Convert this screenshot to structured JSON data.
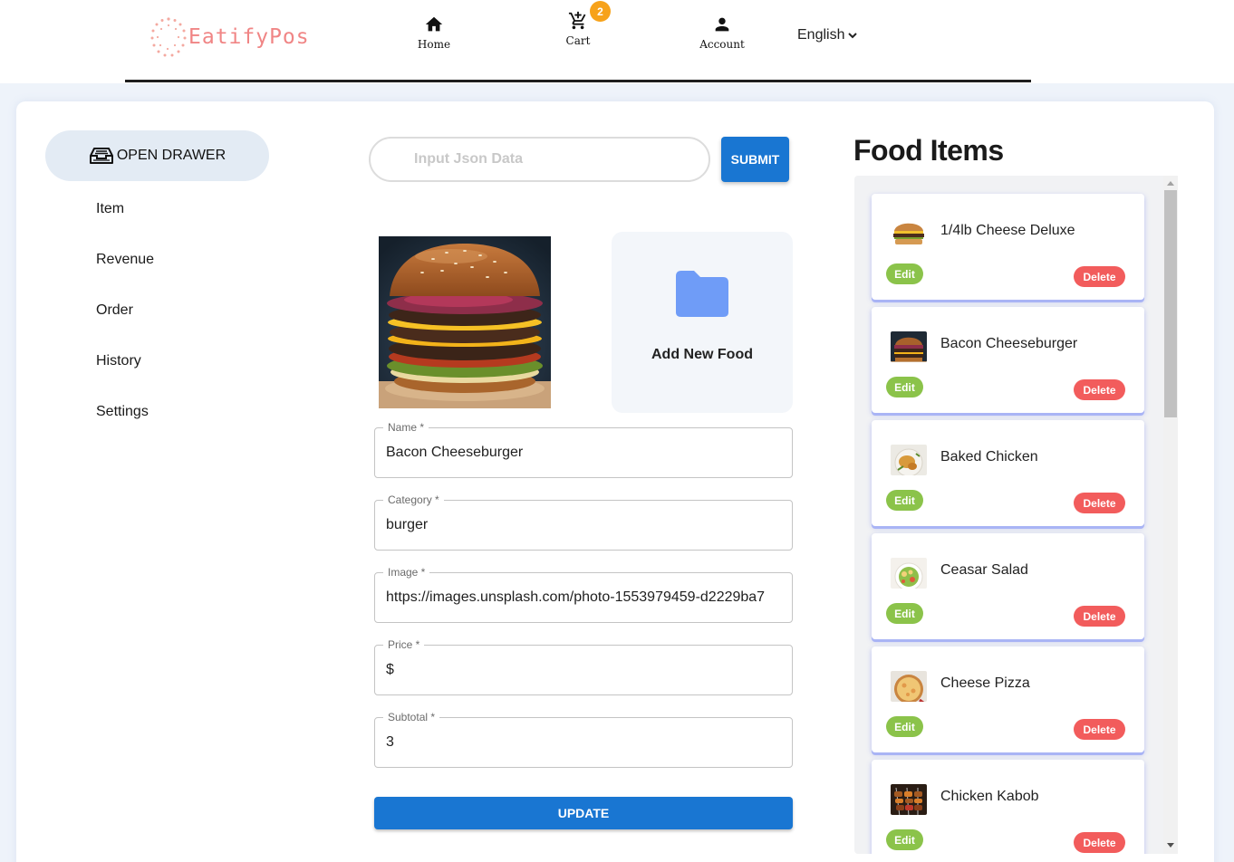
{
  "header": {
    "logo_text": "EatifyPos",
    "nav": {
      "home_label": "Home",
      "cart_label": "Cart",
      "cart_count": "2",
      "account_label": "Account"
    },
    "language": "English"
  },
  "sidebar": {
    "drawer_button": "OPEN DRAWER",
    "items": [
      "Item",
      "Revenue",
      "Order",
      "History",
      "Settings"
    ]
  },
  "json_input": {
    "placeholder": "Input Json Data",
    "submit_label": "SUBMIT"
  },
  "add_food_label": "Add New Food",
  "form": {
    "name_label": "Name *",
    "name_value": "Bacon Cheeseburger",
    "category_label": "Category *",
    "category_value": "burger",
    "image_label": "Image *",
    "image_value": "https://images.unsplash.com/photo-1553979459-d2229ba7",
    "price_label": "Price *",
    "price_value": "$",
    "subtotal_label": "Subtotal *",
    "subtotal_value": "3",
    "update_label": "UPDATE"
  },
  "food_items": {
    "title": "Food Items",
    "edit_label": "Edit",
    "delete_label": "Delete",
    "items": [
      {
        "name": "1/4lb Cheese Deluxe"
      },
      {
        "name": "Bacon Cheeseburger"
      },
      {
        "name": "Baked Chicken"
      },
      {
        "name": "Ceasar Salad"
      },
      {
        "name": "Cheese Pizza"
      },
      {
        "name": "Chicken Kabob"
      }
    ]
  },
  "colors": {
    "primary": "#1976d2",
    "edit": "#8bc34a",
    "delete": "#f25c5c",
    "logo": "#f08585",
    "badge": "#f7a21a",
    "folder": "#6f9cf7"
  }
}
